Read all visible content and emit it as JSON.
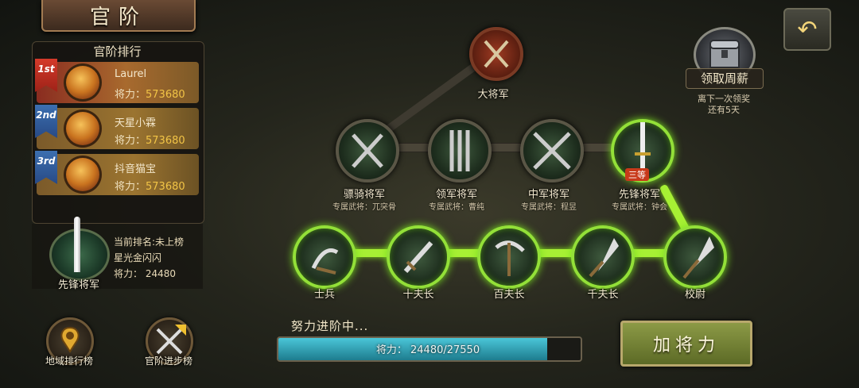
{
  "title": "官阶",
  "ranking": {
    "title": "官阶排行",
    "entries": [
      {
        "rank": "1st",
        "name": "Laurel",
        "power_label": "将力：",
        "power": "573680"
      },
      {
        "rank": "2nd",
        "name": "天星小霖",
        "power_label": "将力：",
        "power": "573680"
      },
      {
        "rank": "3rd",
        "name": "抖音猫宝",
        "power_label": "将力：",
        "power": "573680"
      }
    ]
  },
  "my_rank": {
    "title": "先锋将军",
    "current_rank": "当前排名:未上榜",
    "name": "星光金闪闪",
    "power": "将力：  24480"
  },
  "buttons": {
    "region_rank": "地域排行榜",
    "rank_progress": "官阶进步榜",
    "add_power": "加将力",
    "weekly_salary": "领取周薪"
  },
  "weekly_note": [
    "离下一次领奖",
    "还有5天"
  ],
  "top_node": {
    "label": "大将军"
  },
  "generals": [
    {
      "label": "骠骑将军",
      "sub": "专属武将：兀突骨"
    },
    {
      "label": "领军将军",
      "sub": "专属武将：曹纯"
    },
    {
      "label": "中军将军",
      "sub": "专属武将：程昱"
    },
    {
      "label": "先锋将军",
      "sub": "专属武将：钟会",
      "badge": "三等"
    }
  ],
  "soldiers": [
    {
      "label": "士兵"
    },
    {
      "label": "十夫长"
    },
    {
      "label": "百夫长"
    },
    {
      "label": "千夫长"
    },
    {
      "label": "校尉"
    }
  ],
  "progress": {
    "label": "努力进阶中...",
    "text": "将力： 24480/27550",
    "current": 24480,
    "max": 27550
  },
  "icons": {
    "back": "back-arrow-icon",
    "chest": "treasure-chest-icon"
  }
}
